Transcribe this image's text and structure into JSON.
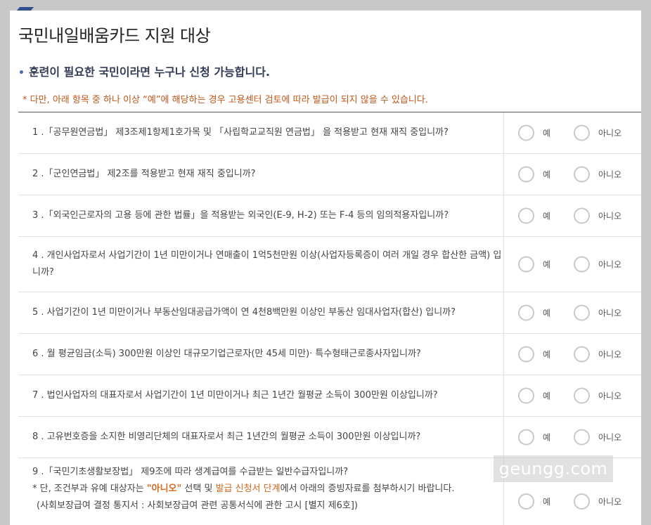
{
  "title": "국민내일배움카드 지원 대상",
  "subtitle": "훈련이 필요한 국민이라면 누구나 신청 가능합니다.",
  "subtitle_bullet": "•",
  "notice": "* 다만, 아래 항목 중 하나 이상 “예”에 해당하는 경우 고용센터 검토에 따라 발급이 되지 않을 수 있습니다.",
  "options": {
    "yes": "예",
    "no": "아니오"
  },
  "questions": [
    {
      "text": "1 .「공무원연금법」 제3조제1항제1호가목 및 「사립학교교직원 연금법」 을 적용받고 현재 재직 중입니까?"
    },
    {
      "text": "2 .「군인연금법」 제2조를 적용받고 현재 재직 중입니까?"
    },
    {
      "text": "3 .「외국인근로자의 고용 등에 관한 법률」을 적용받는 외국인(E-9, H-2) 또는 F-4 등의 임의적용자입니까?"
    },
    {
      "text": "4 . 개인사업자로서 사업기간이 1년 미만이거나 연매출이 1억5천만원 이상(사업자등록증이 여러 개일 경우 합산한 금액) 입니까?"
    },
    {
      "text": "5 . 사업기간이 1년 미만이거나 부동산임대공급가액이 연 4천8백만원 이상인 부동산 임대사업자(합산) 입니까?"
    },
    {
      "text": "6 . 월 평균임금(소득) 300만원 이상인 대규모기업근로자(만 45세 미만)· 특수형태근로종사자입니까?"
    },
    {
      "text": "7 . 법인사업자의 대표자로서 사업기간이 1년 미만이거나 최근 1년간 월평균 소득이 300만원 이상입니까?"
    },
    {
      "text": "8 . 고유번호증을 소지한 비영리단체의 대표자로서 최근 1년간의 월평균 소득이 300만원 이상입니까?"
    }
  ],
  "q9": {
    "line1": "9 .「국민기초생활보장법」 제9조에 따라 생계급여를 수급받는 일반수급자입니까?",
    "line2_pre": "* 단, 조건부과 유예 대상자는 ",
    "line2_hl1": "\"아니오\"",
    "line2_mid": " 선택 및 ",
    "line2_hl2": "발급 신청서 단계",
    "line2_post": "에서 아래의 증빙자료를 첨부하시기 바랍니다.",
    "line3": "(사회보장급여 결정 통지서 : 사회보장급여 관련 공통서식에 관한 고시 [별지 제6호])"
  },
  "watermark": "geungg.com"
}
